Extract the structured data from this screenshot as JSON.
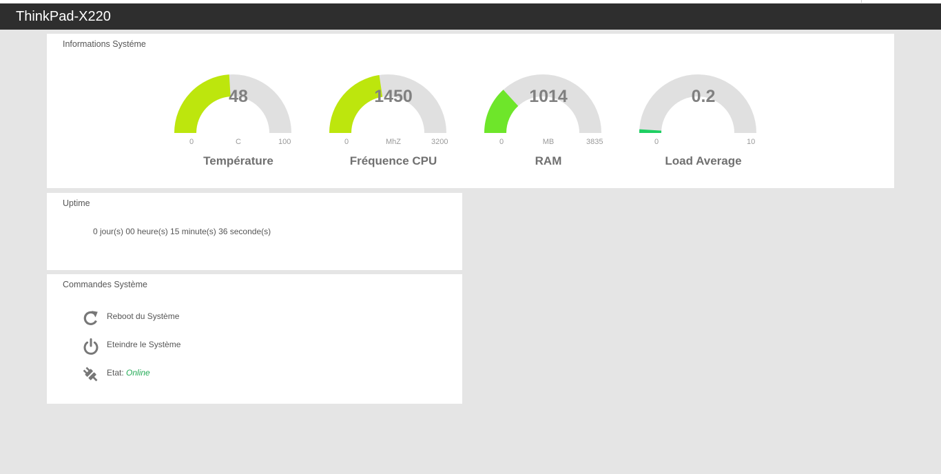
{
  "header": {
    "title": "ThinkPad-X220"
  },
  "info_panel": {
    "title": "Informations Systéme",
    "gauges": [
      {
        "label": "Température",
        "value": "48",
        "unit": "C",
        "min": "0",
        "max": "100",
        "fraction": 0.48,
        "color": "#bde60d"
      },
      {
        "label": "Fréquence CPU",
        "value": "1450",
        "unit": "MhZ",
        "min": "0",
        "max": "3200",
        "fraction": 0.453,
        "color": "#bde60d"
      },
      {
        "label": "RAM",
        "value": "1014",
        "unit": "MB",
        "min": "0",
        "max": "3835",
        "fraction": 0.264,
        "color": "#6ee62a"
      },
      {
        "label": "Load Average",
        "value": "0.2",
        "unit": "",
        "min": "0",
        "max": "10",
        "fraction": 0.02,
        "color": "#1ecf62"
      }
    ],
    "track_color": "#e0e0e0"
  },
  "uptime_panel": {
    "title": "Uptime",
    "text": "0 jour(s) 00 heure(s) 15 minute(s) 36 seconde(s)"
  },
  "commands_panel": {
    "title": "Commandes Système",
    "reboot_label": "Reboot du Système",
    "reboot_icon": "refresh-icon",
    "shutdown_label": "Eteindre le Système",
    "shutdown_icon": "power-icon",
    "state_label": "Etat:",
    "state_value": "Online",
    "state_icon": "plug-icon"
  }
}
